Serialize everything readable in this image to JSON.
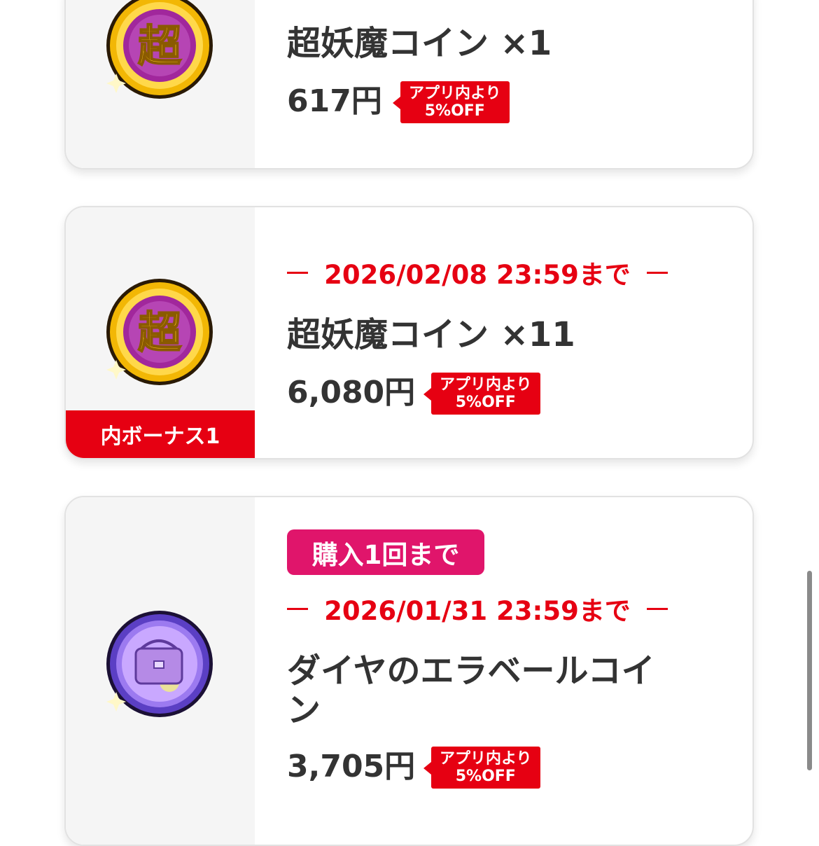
{
  "products": [
    {
      "icon": "super-yokai-coin-icon",
      "title": "超妖魔コイン ×1",
      "price": "617円",
      "discount": {
        "line1": "アプリ内より",
        "line2": "5%OFF"
      }
    },
    {
      "icon": "super-yokai-coin-icon",
      "deadline": "2026/02/08 23:59まで",
      "title": "超妖魔コイン ×11",
      "price": "6,080円",
      "bonus": "内ボーナス1",
      "discount": {
        "line1": "アプリ内より",
        "line2": "5%OFF"
      }
    },
    {
      "icon": "diamond-erabell-coin-icon",
      "limit": "購入1回まで",
      "deadline": "2026/01/31 23:59まで",
      "title_line1": "ダイヤのエラベールコイ",
      "title_line2": "ン",
      "price": "3,705円",
      "discount": {
        "line1": "アプリ内より",
        "line2": "5%OFF"
      }
    }
  ],
  "colors": {
    "accent_red": "#e60012",
    "limit_pink": "#e0156b",
    "text": "#333333",
    "card_left_bg": "#f5f5f5"
  }
}
